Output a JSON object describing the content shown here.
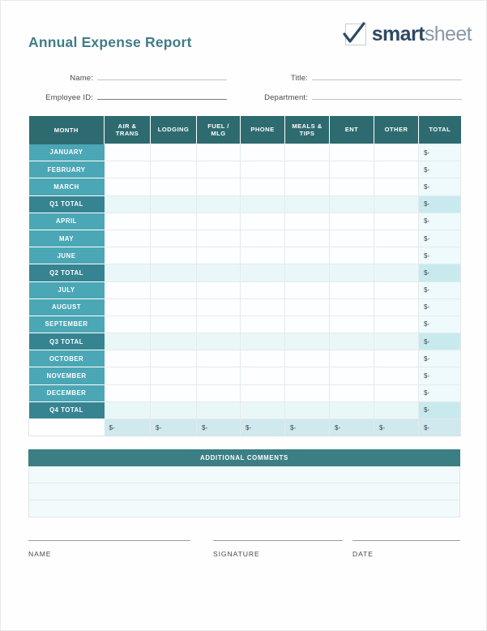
{
  "document": {
    "title": "Annual Expense Report"
  },
  "brand": {
    "logo_icon": "checkbox-check-icon",
    "name_bold": "smart",
    "name_light": "sheet",
    "dark_teal": "#2e6b70",
    "mid_teal": "#4ba7b5",
    "quarter_teal": "#368391",
    "title_color": "#417d87",
    "logo_dark": "#2e4a62",
    "logo_light": "#8a98a6"
  },
  "form": {
    "fields": [
      {
        "label": "Name:",
        "value": "",
        "placeholder": ""
      },
      {
        "label": "Employee ID:",
        "value": "",
        "placeholder": ""
      },
      {
        "label": "Title:",
        "value": "",
        "placeholder": ""
      },
      {
        "label": "Department:",
        "value": "",
        "placeholder": ""
      }
    ]
  },
  "table": {
    "columns": [
      "MONTH",
      "AIR &\nTRANS",
      "LODGING",
      "FUEL /\nMLG",
      "PHONE",
      "MEALS &\nTIPS",
      "ENT",
      "OTHER",
      "TOTAL"
    ],
    "columns_display": {
      "month": "MONTH",
      "air_trans_line1": "AIR &",
      "air_trans_line2": "TRANS",
      "lodging": "LODGING",
      "fuel_line1": "FUEL /",
      "fuel_line2": "MLG",
      "phone": "PHONE",
      "meals_line1": "MEALS &",
      "meals_line2": "TIPS",
      "ent": "ENT",
      "other": "OTHER",
      "total": "TOTAL"
    },
    "zero_value": "$-",
    "rows": [
      {
        "label": "JANUARY",
        "type": "month",
        "values": [
          "",
          "",
          "",
          "",
          "",
          "",
          ""
        ],
        "total": "$-"
      },
      {
        "label": "FEBRUARY",
        "type": "month",
        "values": [
          "",
          "",
          "",
          "",
          "",
          "",
          ""
        ],
        "total": "$-"
      },
      {
        "label": "MARCH",
        "type": "month",
        "values": [
          "",
          "",
          "",
          "",
          "",
          "",
          ""
        ],
        "total": "$-"
      },
      {
        "label": "Q1 TOTAL",
        "type": "qtr",
        "values": [
          "",
          "",
          "",
          "",
          "",
          "",
          ""
        ],
        "total": "$-"
      },
      {
        "label": "APRIL",
        "type": "month",
        "values": [
          "",
          "",
          "",
          "",
          "",
          "",
          ""
        ],
        "total": "$-"
      },
      {
        "label": "MAY",
        "type": "month",
        "values": [
          "",
          "",
          "",
          "",
          "",
          "",
          ""
        ],
        "total": "$-"
      },
      {
        "label": "JUNE",
        "type": "month",
        "values": [
          "",
          "",
          "",
          "",
          "",
          "",
          ""
        ],
        "total": "$-"
      },
      {
        "label": "Q2 TOTAL",
        "type": "qtr",
        "values": [
          "",
          "",
          "",
          "",
          "",
          "",
          ""
        ],
        "total": "$-"
      },
      {
        "label": "JULY",
        "type": "month",
        "values": [
          "",
          "",
          "",
          "",
          "",
          "",
          ""
        ],
        "total": "$-"
      },
      {
        "label": "AUGUST",
        "type": "month",
        "values": [
          "",
          "",
          "",
          "",
          "",
          "",
          ""
        ],
        "total": "$-"
      },
      {
        "label": "SEPTEMBER",
        "type": "month",
        "values": [
          "",
          "",
          "",
          "",
          "",
          "",
          ""
        ],
        "total": "$-"
      },
      {
        "label": "Q3 TOTAL",
        "type": "qtr",
        "values": [
          "",
          "",
          "",
          "",
          "",
          "",
          ""
        ],
        "total": "$-"
      },
      {
        "label": "OCTOBER",
        "type": "month",
        "values": [
          "",
          "",
          "",
          "",
          "",
          "",
          ""
        ],
        "total": "$-"
      },
      {
        "label": "NOVEMBER",
        "type": "month",
        "values": [
          "",
          "",
          "",
          "",
          "",
          "",
          ""
        ],
        "total": "$-"
      },
      {
        "label": "DECEMBER",
        "type": "month",
        "values": [
          "",
          "",
          "",
          "",
          "",
          "",
          ""
        ],
        "total": "$-"
      },
      {
        "label": "Q4 TOTAL",
        "type": "qtr",
        "values": [
          "",
          "",
          "",
          "",
          "",
          "",
          ""
        ],
        "total": "$-"
      },
      {
        "label": "",
        "type": "grand",
        "values": [
          "$-",
          "$-",
          "$-",
          "$-",
          "$-",
          "$-",
          "$-"
        ],
        "total": "$-"
      }
    ]
  },
  "comments": {
    "heading": "ADDITIONAL COMMENTS",
    "rows": [
      "",
      "",
      ""
    ]
  },
  "signature": {
    "name_label": "NAME",
    "signature_label": "SIGNATURE",
    "date_label": "DATE"
  }
}
